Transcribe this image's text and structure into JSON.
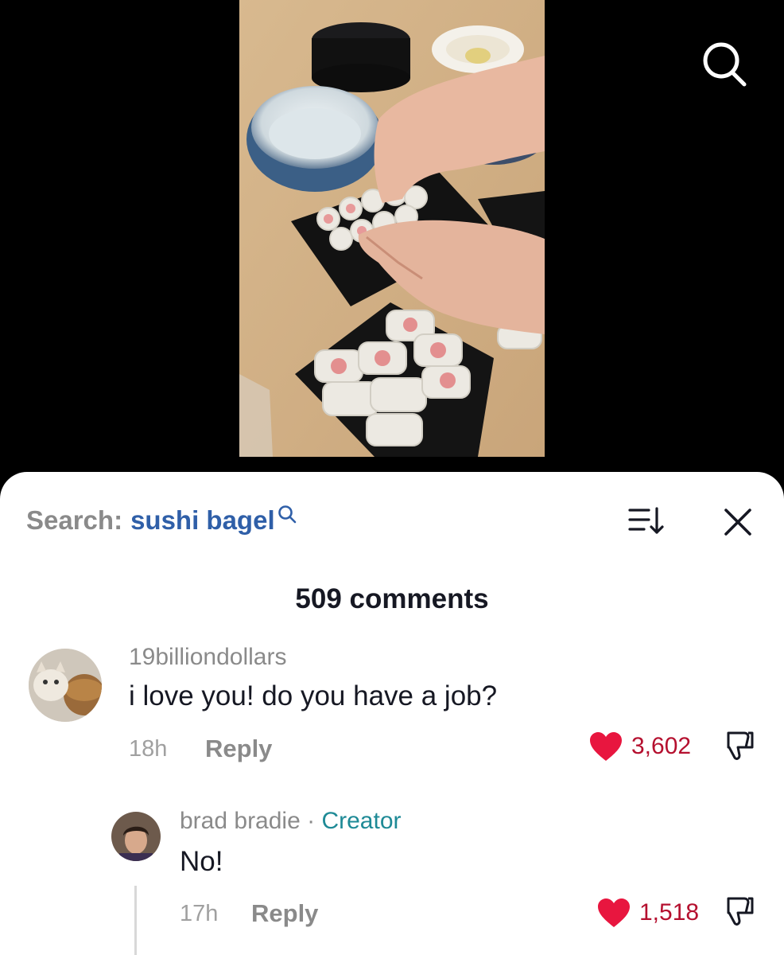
{
  "icons": {
    "top_search": "search-icon",
    "inline_search": "search-icon",
    "sort": "sort-icon",
    "close": "close-icon",
    "like": "heart-icon",
    "dislike": "thumbs-down-icon"
  },
  "colors": {
    "accent_query": "#2f5fa8",
    "creator_tag": "#1e8a96",
    "like_red": "#e8163f",
    "like_count": "#b5102f"
  },
  "search": {
    "prefix": "Search:",
    "query": "sushi bagel"
  },
  "comments_count": "509 comments",
  "comments": [
    {
      "username": "19billiondollars",
      "text": "i love you! do you have a job?",
      "time": "18h",
      "reply_label": "Reply",
      "likes": "3,602"
    },
    {
      "username": "brad bradie",
      "separator": "·",
      "badge": "Creator",
      "text": "No!",
      "time": "17h",
      "reply_label": "Reply",
      "likes": "1,518"
    }
  ]
}
